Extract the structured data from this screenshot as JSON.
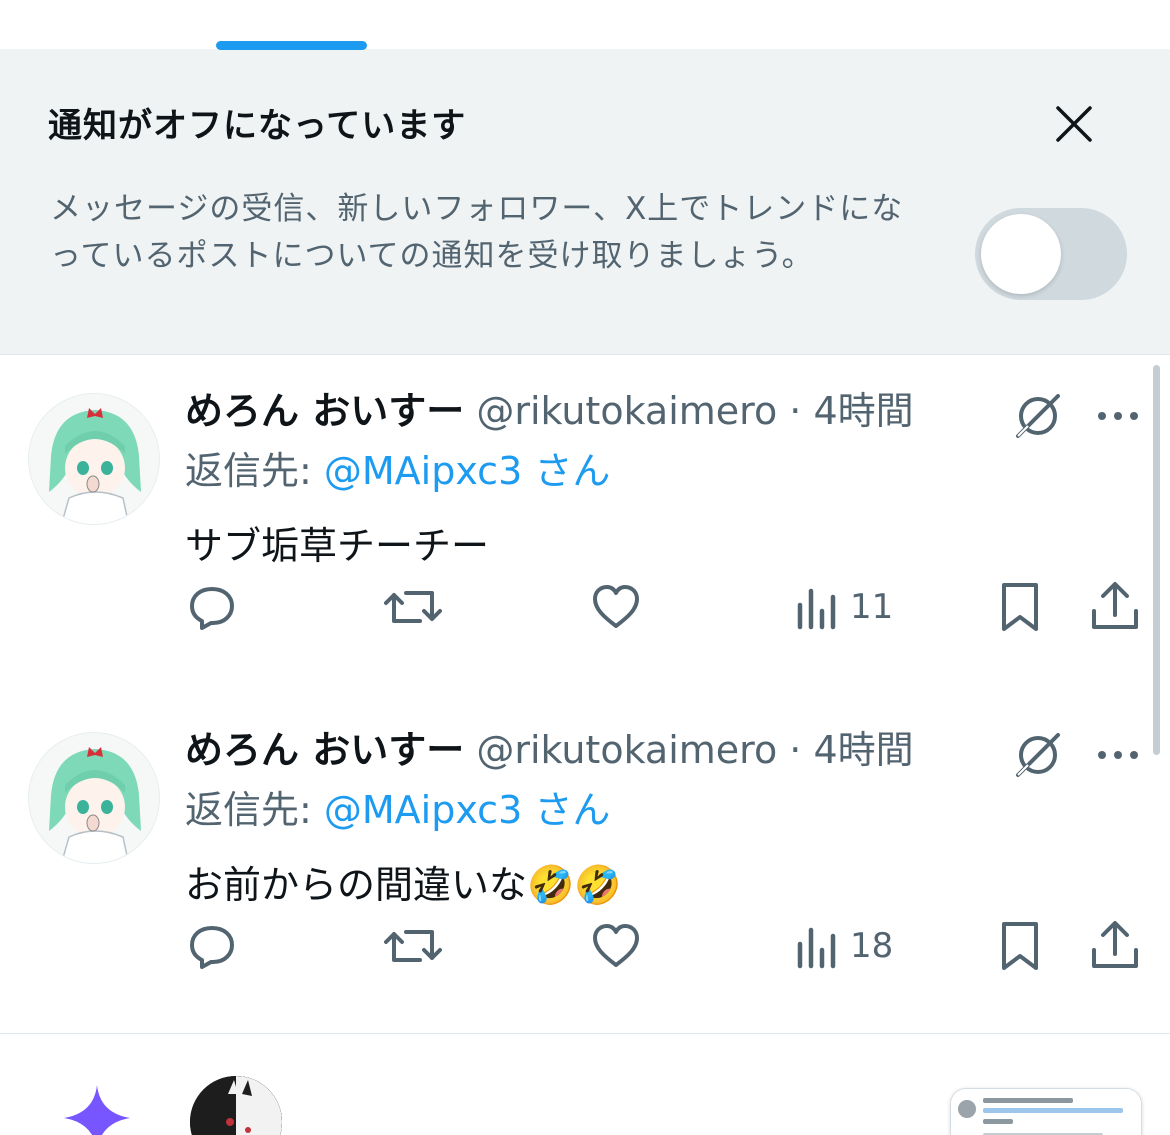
{
  "banner": {
    "title": "通知がオフになっています",
    "description": "メッセージの受信、新しいフォロワー、X上でトレンドになっているポストについての通知を受け取りましょう。",
    "toggle_on": false
  },
  "posts": [
    {
      "display_name": "めろん おいすー",
      "handle": "@rikutokaimero",
      "separator": "·",
      "time": "4時間",
      "reply_prefix": "返信先: ",
      "reply_target": "@MAipxc3 さん",
      "text": "サブ垢草チーチー",
      "views": "11"
    },
    {
      "display_name": "めろん おいすー",
      "handle": "@rikutokaimero",
      "separator": "·",
      "time": "4時間",
      "reply_prefix": "返信先: ",
      "reply_target": "@MAipxc3 さん",
      "text": "お前からの間違いな🤣🤣",
      "views": "18"
    }
  ],
  "colors": {
    "accent": "#1d9bf0",
    "secondary_text": "#536471",
    "banner_bg": "#eff3f4",
    "grok_purple": "#7856ff"
  },
  "icons": [
    "close-icon",
    "grok-icon",
    "more-icon",
    "reply-icon",
    "repost-icon",
    "like-icon",
    "views-icon",
    "bookmark-icon",
    "share-icon",
    "grok-star-icon"
  ]
}
